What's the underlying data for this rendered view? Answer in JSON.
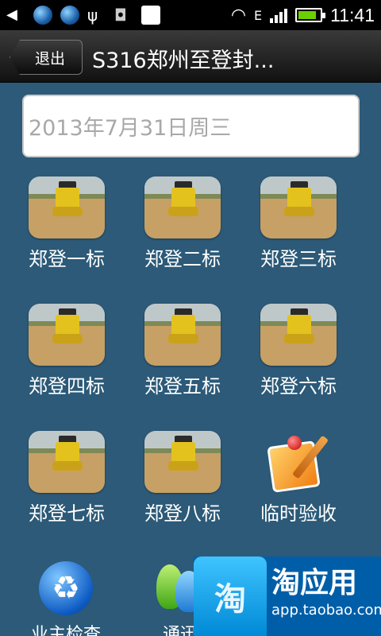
{
  "status_bar": {
    "time": "11:41",
    "icons": [
      "notification-icon",
      "globe-icon",
      "globe-icon",
      "usb-icon",
      "android-icon",
      "image-icon",
      "wifi-icon",
      "data-e-icon",
      "signal-icon",
      "battery-charging-icon"
    ]
  },
  "header": {
    "back_label": "退出",
    "title": "S316郑州至登封..."
  },
  "date_field": {
    "value": "2013年7月31日周三"
  },
  "grid": {
    "items": [
      {
        "label": "郑登一标"
      },
      {
        "label": "郑登二标"
      },
      {
        "label": "郑登三标"
      },
      {
        "label": "郑登四标"
      },
      {
        "label": "郑登五标"
      },
      {
        "label": "郑登六标"
      },
      {
        "label": "郑登七标"
      },
      {
        "label": "郑登八标"
      },
      {
        "label": "临时验收"
      }
    ]
  },
  "bottom": {
    "items": [
      {
        "label": "业主检查"
      },
      {
        "label": "通迅"
      }
    ]
  },
  "overlay": {
    "brand": "淘应用",
    "url": "app.taobao.com",
    "bag_text": "淘"
  },
  "colors": {
    "background": "#2c5a78",
    "status_bar": "#000000",
    "title_bar": "#1c1c1c",
    "label_text": "#ffffff",
    "date_text": "#a8a8a8",
    "overlay": "#005ea8"
  }
}
